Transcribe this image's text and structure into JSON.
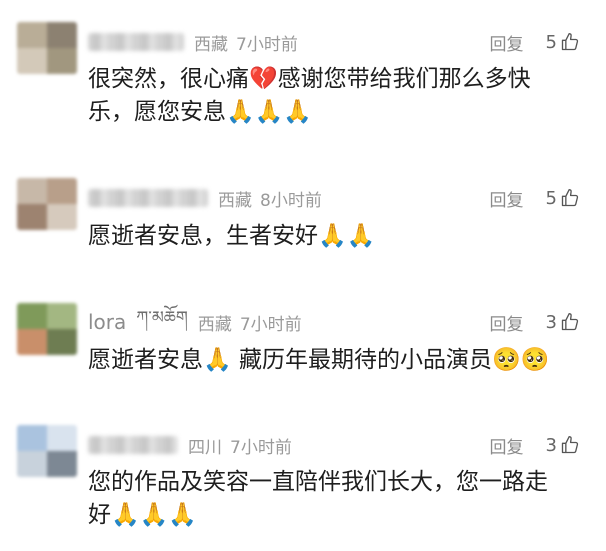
{
  "comments": [
    {
      "name": "",
      "region": "西藏",
      "time": "7小时前",
      "reply": "回复",
      "likes": "5",
      "text_lines": [
        "很突然，很心痛💔感谢您带给我们那么多快",
        "乐，愿您安息🙏🙏🙏"
      ]
    },
    {
      "name": "",
      "region": "西藏",
      "time": "8小时前",
      "reply": "回复",
      "likes": "5",
      "text_lines": [
        "愿逝者安息，生者安好🙏🙏"
      ]
    },
    {
      "name": "lora",
      "name_suffix": "ཀ་མཆོག",
      "region": "西藏",
      "time": "7小时前",
      "reply": "回复",
      "likes": "3",
      "text_lines": [
        "愿逝者安息🙏 藏历年最期待的小品演员🥺🥺"
      ]
    },
    {
      "name": "",
      "region": "四川",
      "time": "7小时前",
      "reply": "回复",
      "likes": "3",
      "text_lines": [
        "您的作品及笑容一直陪伴我们长大，您一路走",
        "好🙏🙏🙏"
      ]
    }
  ],
  "icons": {
    "like": "thumbs-up-icon",
    "avatar": "user-avatar-blurred"
  },
  "colors": {
    "meta_text": "#9a9a9a",
    "body_text": "#1e1e1e",
    "background": "#ffffff"
  }
}
